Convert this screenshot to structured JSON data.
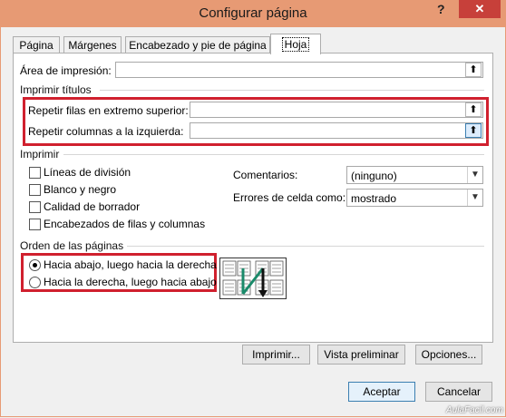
{
  "window": {
    "title": "Configurar página",
    "help": "?",
    "close": "✕"
  },
  "tabs": [
    {
      "label": "Página"
    },
    {
      "label": "Márgenes"
    },
    {
      "label": "Encabezado y pie de página"
    },
    {
      "label": "Hoja",
      "active": true
    }
  ],
  "print_area": {
    "label": "Área de impresión:",
    "value": ""
  },
  "print_titles": {
    "group": "Imprimir títulos",
    "rows_label": "Repetir filas en extremo superior:",
    "rows_value": "",
    "cols_label": "Repetir columnas a la izquierda:",
    "cols_value": ""
  },
  "print": {
    "group": "Imprimir",
    "checkboxes": [
      {
        "label": "Líneas de división",
        "checked": false
      },
      {
        "label": "Blanco y negro",
        "checked": false
      },
      {
        "label": "Calidad de borrador",
        "checked": false
      },
      {
        "label": "Encabezados de filas y columnas",
        "checked": false
      }
    ],
    "comments_label": "Comentarios:",
    "comments_value": "(ninguno)",
    "errors_label": "Errores de celda como:",
    "errors_value": "mostrado"
  },
  "page_order": {
    "group": "Orden de las páginas",
    "options": [
      {
        "label": "Hacia abajo, luego hacia la derecha",
        "selected": true
      },
      {
        "label": "Hacia la derecha, luego hacia abajo",
        "selected": false
      }
    ]
  },
  "buttons": {
    "print": "Imprimir...",
    "preview": "Vista preliminar",
    "options": "Opciones...",
    "ok": "Aceptar",
    "cancel": "Cancelar"
  },
  "watermark": "AulaFacil.com",
  "colors": {
    "titlebar": "#e79a74",
    "close": "#c7403a",
    "highlight": "#d0202e"
  }
}
